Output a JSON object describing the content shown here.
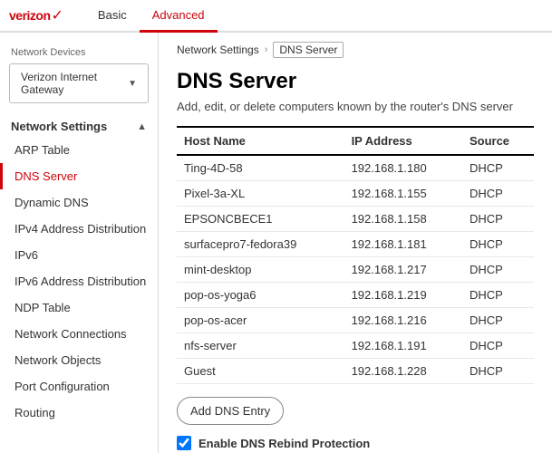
{
  "topNav": {
    "logoText": "verizon",
    "logoCheck": "✓",
    "tabs": [
      {
        "id": "basic",
        "label": "Basic",
        "active": false
      },
      {
        "id": "advanced",
        "label": "Advanced",
        "active": true
      }
    ]
  },
  "sidebar": {
    "sectionLabel": "Network Devices",
    "dropdown": {
      "label": "Verizon Internet Gateway",
      "chevron": "▼"
    },
    "groupLabel": "Network Settings",
    "collapseIcon": "▲",
    "items": [
      {
        "id": "arp-table",
        "label": "ARP Table",
        "active": false
      },
      {
        "id": "dns-server",
        "label": "DNS Server",
        "active": true
      },
      {
        "id": "dynamic-dns",
        "label": "Dynamic DNS",
        "active": false
      },
      {
        "id": "ipv4-address-distribution",
        "label": "IPv4 Address Distribution",
        "active": false
      },
      {
        "id": "ipv6",
        "label": "IPv6",
        "active": false
      },
      {
        "id": "ipv6-address-distribution",
        "label": "IPv6 Address Distribution",
        "active": false
      },
      {
        "id": "ndp-table",
        "label": "NDP Table",
        "active": false
      },
      {
        "id": "network-connections",
        "label": "Network Connections",
        "active": false
      },
      {
        "id": "network-objects",
        "label": "Network Objects",
        "active": false
      },
      {
        "id": "port-configuration",
        "label": "Port Configuration",
        "active": false
      },
      {
        "id": "routing",
        "label": "Routing",
        "active": false
      }
    ]
  },
  "breadcrumb": {
    "parent": "Network Settings",
    "separator": "›",
    "current": "DNS Server"
  },
  "page": {
    "title": "DNS Server",
    "description": "Add, edit, or delete computers known by the router's DNS server"
  },
  "table": {
    "columns": [
      {
        "id": "host-name",
        "label": "Host Name"
      },
      {
        "id": "ip-address",
        "label": "IP Address"
      },
      {
        "id": "source",
        "label": "Source"
      }
    ],
    "rows": [
      {
        "hostName": "Ting-4D-58",
        "ipAddress": "192.168.1.180",
        "source": "DHCP"
      },
      {
        "hostName": "Pixel-3a-XL",
        "ipAddress": "192.168.1.155",
        "source": "DHCP"
      },
      {
        "hostName": "EPSONCBECE1",
        "ipAddress": "192.168.1.158",
        "source": "DHCP"
      },
      {
        "hostName": "surfacepro7-fedora39",
        "ipAddress": "192.168.1.181",
        "source": "DHCP"
      },
      {
        "hostName": "mint-desktop",
        "ipAddress": "192.168.1.217",
        "source": "DHCP"
      },
      {
        "hostName": "pop-os-yoga6",
        "ipAddress": "192.168.1.219",
        "source": "DHCP"
      },
      {
        "hostName": "pop-os-acer",
        "ipAddress": "192.168.1.216",
        "source": "DHCP"
      },
      {
        "hostName": "nfs-server",
        "ipAddress": "192.168.1.191",
        "source": "DHCP"
      },
      {
        "hostName": "Guest",
        "ipAddress": "192.168.1.228",
        "source": "DHCP"
      }
    ]
  },
  "addButton": "Add DNS Entry",
  "dnsRebind": {
    "label": "Enable DNS Rebind Protection",
    "checked": true
  }
}
